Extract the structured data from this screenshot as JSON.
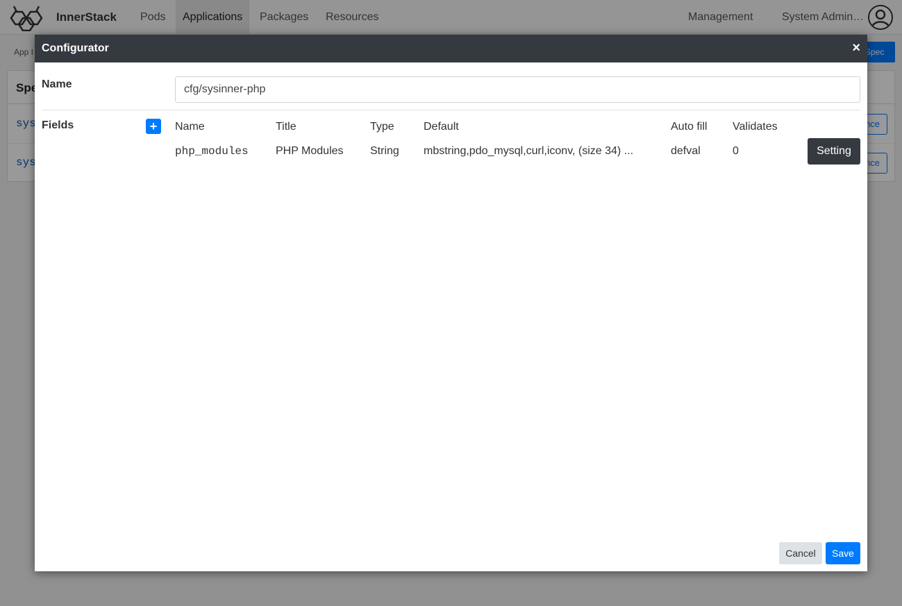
{
  "app": {
    "brand": "InnerStack",
    "nav": [
      "Pods",
      "Applications",
      "Packages",
      "Resources"
    ],
    "active_nav": "Applications",
    "management": "Management",
    "user": "System Admin…"
  },
  "background": {
    "breadcrumb": "App I",
    "action_button": "Spec",
    "card_header": "Spe",
    "rows": [
      {
        "text": "sys",
        "button": "nce"
      },
      {
        "text": "sys",
        "button": "nce"
      }
    ]
  },
  "modal": {
    "title": "Configurator",
    "close_glyph": "×",
    "name_label": "Name",
    "name_value": "cfg/sysinner-php",
    "fields_label": "Fields",
    "add_glyph": "+",
    "columns": [
      "Name",
      "Title",
      "Type",
      "Default",
      "Auto fill",
      "Validates"
    ],
    "fields": [
      {
        "name": "php_modules",
        "title": "PHP Modules",
        "type": "String",
        "default": "mbstring,pdo_mysql,curl,iconv, (size 34) ...",
        "auto_fill": "defval",
        "validates": "0",
        "action": "Setting"
      }
    ],
    "cancel": "Cancel",
    "save": "Save"
  },
  "colors": {
    "header_dark": "#343a40",
    "primary": "#007bff"
  }
}
